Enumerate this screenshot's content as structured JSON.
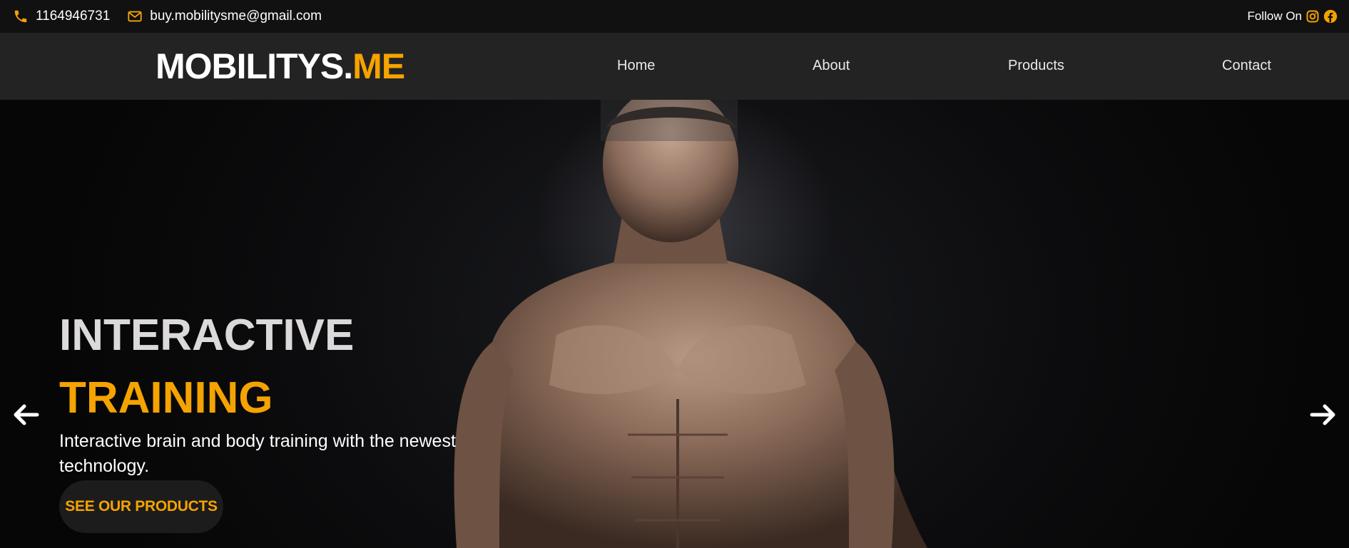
{
  "topbar": {
    "phone": "1164946731",
    "email": "buy.mobilitysme@gmail.com",
    "follow_label": "Follow On",
    "icons": [
      "phone-icon",
      "mail-icon",
      "instagram-icon",
      "facebook-icon"
    ]
  },
  "brand": {
    "name_main": "MOBILITYS.",
    "name_accent": "ME"
  },
  "nav": {
    "items": [
      {
        "label": "Home"
      },
      {
        "label": "About"
      },
      {
        "label": "Products"
      },
      {
        "label": "Contact"
      }
    ]
  },
  "hero": {
    "title_line_1": "INTERACTIVE",
    "title_line_2": "TRAINING",
    "description": "Interactive brain and body training with the newest technology.",
    "cta_label": "SEE OUR PRODUCTS",
    "prev_icon": "arrow-left-icon",
    "next_icon": "arrow-right-icon"
  },
  "colors": {
    "accent": "#f5a300",
    "topbar_bg": "#111112",
    "navbar_bg": "#232323",
    "text": "#ffffff"
  }
}
